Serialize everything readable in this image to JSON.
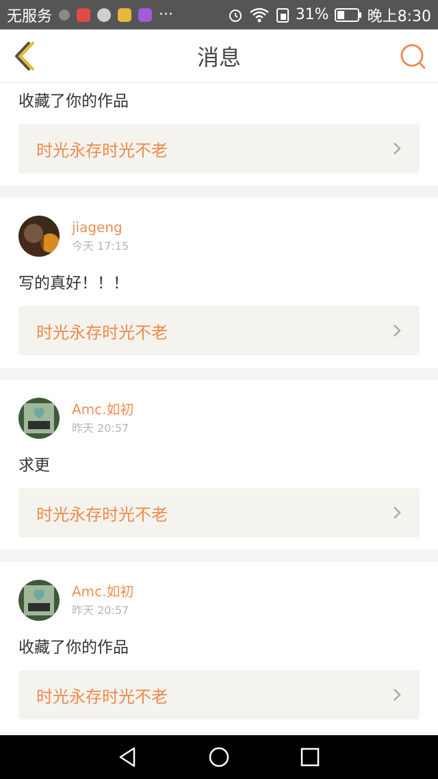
{
  "status_bar": {
    "carrier": "无服务",
    "more": "···",
    "battery_percent": "31%",
    "time": "晚上8:30",
    "app_icon_colors": [
      "#e24a4a",
      "#e8b83a",
      "#a45bd8"
    ]
  },
  "header": {
    "title": "消息"
  },
  "theme": {
    "accent": "#ee8e52",
    "work_bg": "#f4f3ed"
  },
  "messages": [
    {
      "text": "收藏了你的作品",
      "work": "时光永存时光不老"
    },
    {
      "user": "jiageng",
      "time": "今天 17:15",
      "text": "写的真好！！！",
      "work": "时光永存时光不老"
    },
    {
      "user": "Amc.如初",
      "time": "昨天 20:57",
      "text": "求更",
      "work": "时光永存时光不老"
    },
    {
      "user": "Amc.如初",
      "time": "昨天 20:57",
      "text": "收藏了你的作品",
      "work": "时光永存时光不老"
    }
  ]
}
